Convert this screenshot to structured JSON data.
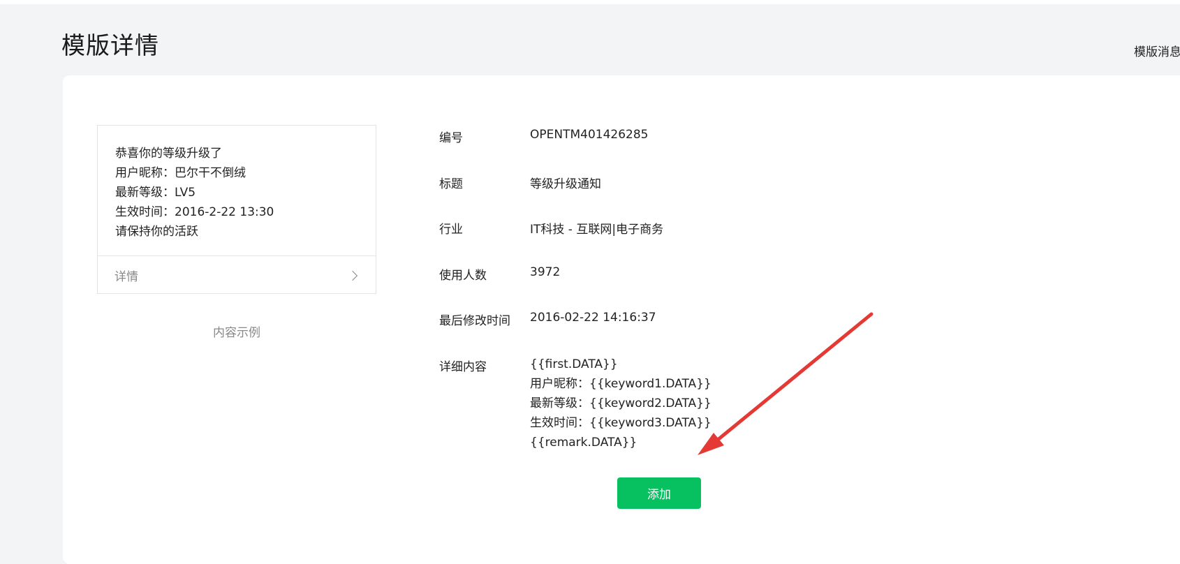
{
  "page": {
    "title": "模版详情",
    "top_right_link": "模版消息"
  },
  "preview": {
    "lines": [
      "恭喜你的等级升级了",
      "用户昵称：巴尔干不倒绒",
      "最新等级：LV5",
      "生效时间：2016-2-22 13:30",
      "请保持你的活跃"
    ],
    "details_link": "详情",
    "caption": "内容示例"
  },
  "info": {
    "id": {
      "label": "编号",
      "value": "OPENTM401426285"
    },
    "title": {
      "label": "标题",
      "value": "等级升级通知"
    },
    "industry": {
      "label": "行业",
      "value": "IT科技 - 互联网|电子商务"
    },
    "users": {
      "label": "使用人数",
      "value": "3972"
    },
    "modified": {
      "label": "最后修改时间",
      "value": "2016-02-22 14:16:37"
    },
    "detail": {
      "label": "详细内容",
      "lines": [
        "{{first.DATA}}",
        "用户昵称：{{keyword1.DATA}}",
        "最新等级：{{keyword2.DATA}}",
        "生效时间：{{keyword3.DATA}}",
        "{{remark.DATA}}"
      ]
    }
  },
  "actions": {
    "add_label": "添加"
  },
  "annotation": {
    "arrow_color": "#e53935"
  },
  "colors": {
    "accent": "#07c160",
    "background": "#f3f4f6"
  }
}
